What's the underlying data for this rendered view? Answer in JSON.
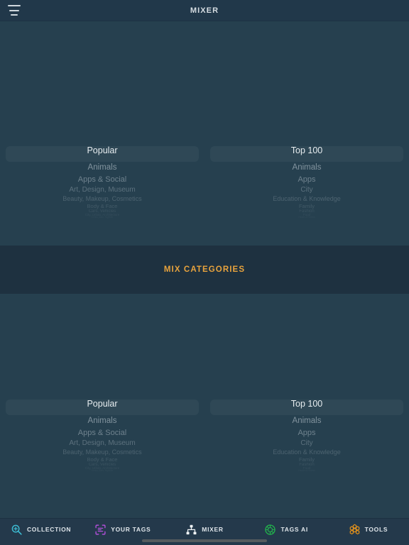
{
  "app": {
    "background_color": "#22394a",
    "panel_color": "#26404f",
    "band_color": "#1e3140"
  },
  "topbar": {
    "menu_icon": "hamburger-icon",
    "title": "MIXER"
  },
  "pickers": [
    {
      "id": "picker-top-left",
      "selected": "Popular",
      "items": [
        "Popular",
        "Animals",
        "Apps & Social",
        "Art, Design, Museum",
        "Beauty, Makeup, Cosmetics",
        "Body & Face",
        "Cars, Vehicles",
        "City, Urban, Architecture",
        "Drinks, Bars, Nightlife"
      ]
    },
    {
      "id": "picker-top-right",
      "selected": "Top 100",
      "items": [
        "Top 100",
        "Animals",
        "Apps",
        "City",
        "Education & Knowledge",
        "Family",
        "Fashion",
        "Food",
        "Health & Fitness"
      ]
    },
    {
      "id": "picker-bottom-left",
      "selected": "Popular",
      "items": [
        "Popular",
        "Animals",
        "Apps & Social",
        "Art, Design, Museum",
        "Beauty, Makeup, Cosmetics",
        "Body & Face",
        "Cars, Vehicles",
        "City, Urban, Architecture",
        "Drinks, Bars, Nightlife"
      ]
    },
    {
      "id": "picker-bottom-right",
      "selected": "Top 100",
      "items": [
        "Top 100",
        "Animals",
        "Apps",
        "City",
        "Education & Knowledge",
        "Family",
        "Fashion",
        "Food",
        "Health & Fitness"
      ]
    }
  ],
  "mix": {
    "label": "MIX CATEGORIES",
    "color": "#e8a33d"
  },
  "tabbar": {
    "items": [
      {
        "label": "COLLECTION",
        "icon": "search-plus-icon",
        "color": "#3ec1d8",
        "active": false
      },
      {
        "label": "YOUR TAGS",
        "icon": "tag-scan-icon",
        "color": "#b04fd8",
        "active": false
      },
      {
        "label": "MIXER",
        "icon": "sitemap-icon",
        "color": "#f0f4f6",
        "active": true
      },
      {
        "label": "TAGS AI",
        "icon": "ai-circle-icon",
        "color": "#22b14c",
        "active": false
      },
      {
        "label": "TOOLS",
        "icon": "honeycomb-icon",
        "color": "#e8941a",
        "active": false
      }
    ],
    "home_indicator": "home-indicator"
  }
}
